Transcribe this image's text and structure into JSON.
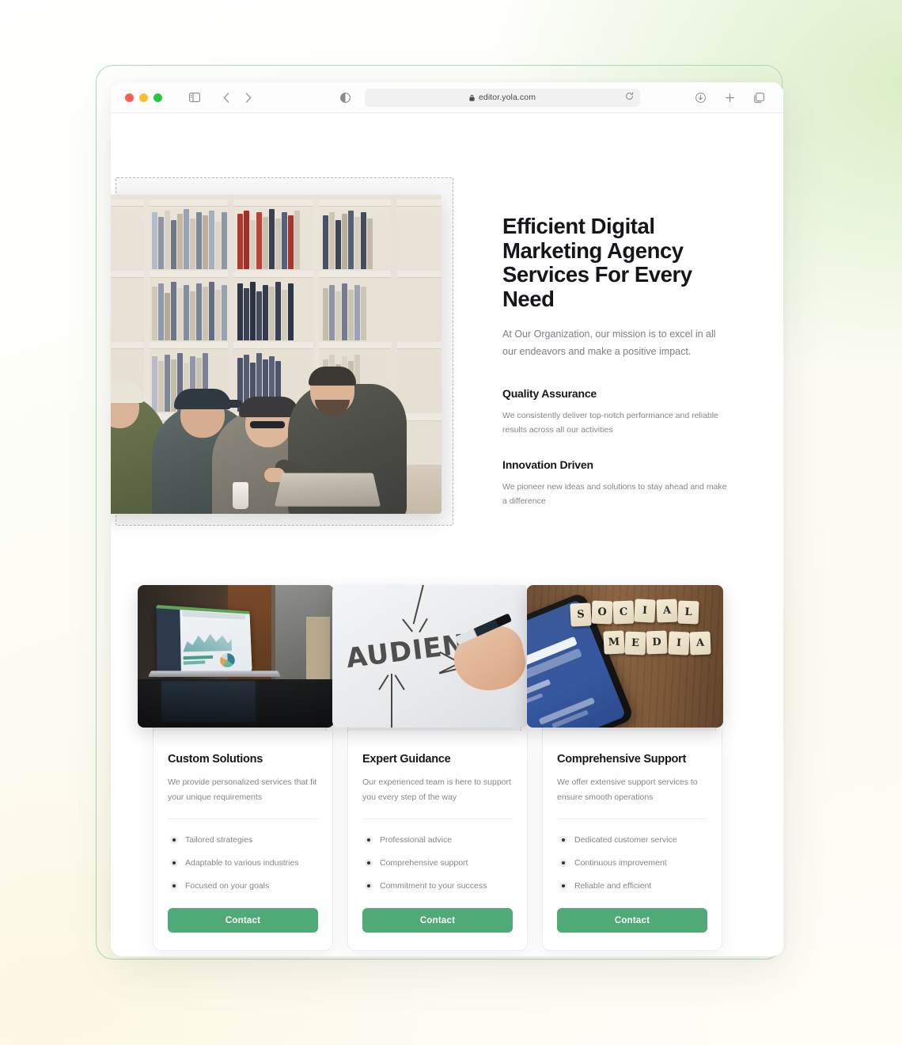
{
  "browser": {
    "url": "editor.yola.com",
    "lock_icon": "lock-icon",
    "reload_icon": "reload-icon",
    "sidebar_icon": "sidebar-toggle-icon",
    "back_icon": "chevron-left-icon",
    "forward_icon": "chevron-right-icon",
    "reader_icon": "reader-mode-icon",
    "download_icon": "download-icon",
    "new_tab_icon": "plus-icon",
    "tabs_icon": "tab-overview-icon",
    "traffic_lights": [
      "close",
      "minimize",
      "zoom"
    ]
  },
  "hero": {
    "title": "Efficient Digital Marketing Agency Services For Every Need",
    "subtitle": "At Our Organization, our mission is to excel in all our endeavors and make a positive impact.",
    "image_alt": "team-collaborating-in-library",
    "features": [
      {
        "title": "Quality Assurance",
        "body": "We consistently deliver top-notch performance and reliable results across all our activities"
      },
      {
        "title": "Innovation Driven",
        "body": "We pioneer new ideas and solutions to stay ahead and make a difference"
      }
    ]
  },
  "cards": [
    {
      "image_alt": "laptop-showing-analytics-dashboard",
      "title": "Custom Solutions",
      "description": "We provide personalized services that fit your unique requirements",
      "bullets": [
        "Tailored strategies",
        "Adaptable to various industries",
        "Focused on your goals"
      ],
      "button_label": "Contact"
    },
    {
      "image_alt": "whiteboard-with-audience-diagram",
      "title": "Expert Guidance",
      "description": "Our experienced team is here to support you every step of the way",
      "bullets": [
        "Professional advice",
        "Comprehensive support",
        "Commitment to your success"
      ],
      "button_label": "Contact"
    },
    {
      "image_alt": "social-media-scrabble-tiles-with-phone",
      "title": "Comprehensive Support",
      "description": "We offer extensive support services to ensure smooth operations",
      "bullets": [
        "Dedicated customer service",
        "Continuous improvement",
        "Reliable and efficient"
      ],
      "button_label": "Contact"
    }
  ],
  "whiteboard": {
    "word": "AUDIENCE"
  },
  "scrabble": {
    "line1": "SOCIAL",
    "line2": "MEDIA"
  },
  "colors": {
    "accent_green": "#4faa77",
    "frame_green": "#a8dcb4",
    "heading": "#16161a",
    "body_text": "#85858d",
    "dashed_border": "#b9b9b9"
  }
}
